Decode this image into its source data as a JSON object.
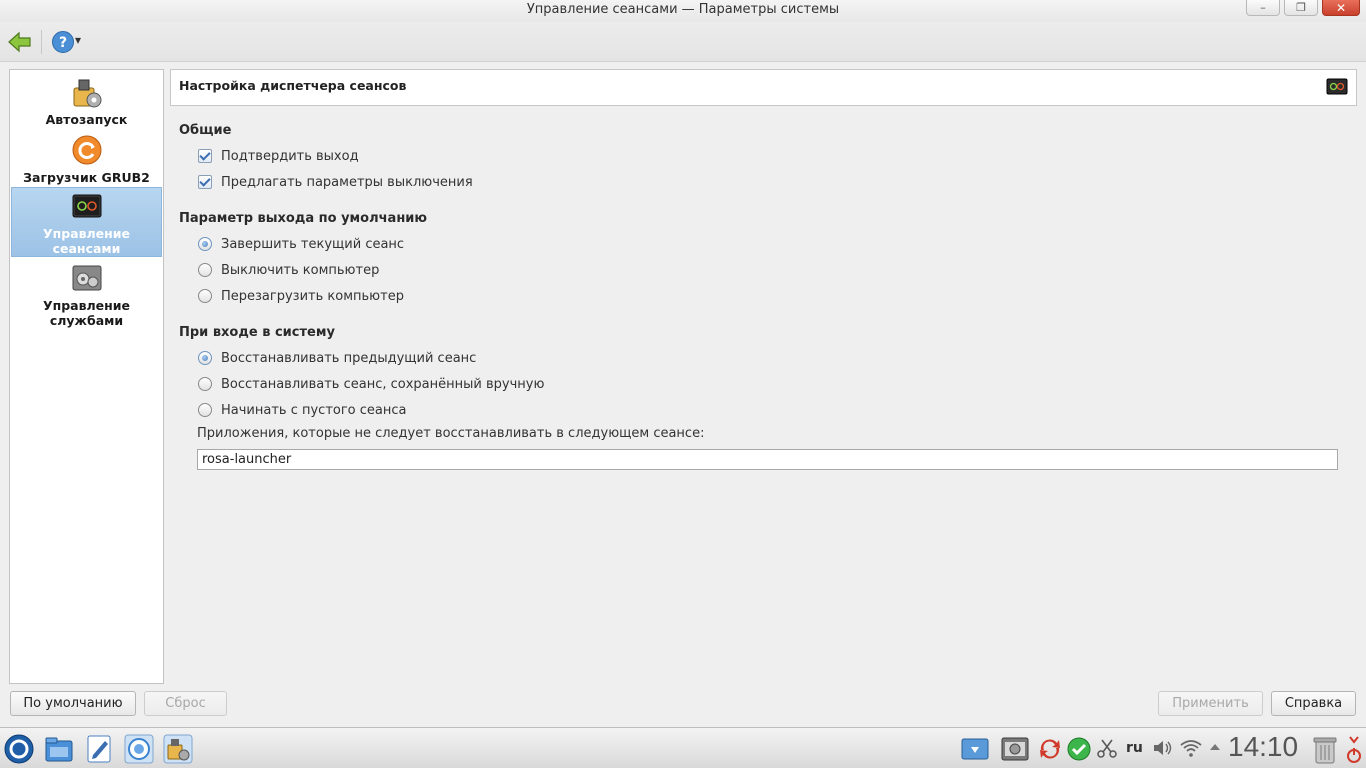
{
  "window": {
    "title": "Управление сеансами — Параметры системы",
    "buttons": {
      "minimize": "–",
      "maximize": "❐",
      "close": "✕"
    }
  },
  "toolbar": {
    "back_icon": "back-arrow-icon",
    "help_icon": "help-question-icon",
    "help_dropdown": "▾"
  },
  "sidebar": {
    "items": [
      {
        "label": "Автозапуск",
        "icon": "autostart-icon"
      },
      {
        "label": "Загрузчик GRUB2",
        "icon": "grub-icon"
      },
      {
        "label": "Управление сеансами",
        "icon": "session-icon",
        "selected": true
      },
      {
        "label": "Управление службами",
        "icon": "services-icon"
      }
    ]
  },
  "header": {
    "title": "Настройка диспетчера сеансов",
    "icon": "session-manager-icon"
  },
  "sections": {
    "general": {
      "title": "Общие",
      "confirm_logout": {
        "label": "Подтвердить выход",
        "checked": true
      },
      "offer_shutdown": {
        "label": "Предлагать параметры выключения",
        "checked": true
      }
    },
    "default_leave": {
      "title": "Параметр выхода по умолчанию",
      "options": [
        {
          "label": "Завершить текущий сеанс",
          "checked": true
        },
        {
          "label": "Выключить компьютер",
          "checked": false
        },
        {
          "label": "Перезагрузить компьютер",
          "checked": false
        }
      ]
    },
    "on_login": {
      "title": "При входе в систему",
      "options": [
        {
          "label": "Восстанавливать предыдущий сеанс",
          "checked": true
        },
        {
          "label": "Восстанавливать сеанс, сохранённый вручную",
          "checked": false
        },
        {
          "label": "Начинать с пустого сеанса",
          "checked": false
        }
      ],
      "exclude_label": "Приложения, которые не следует восстанавливать в следующем сеансе:",
      "exclude_value": "rosa-launcher"
    }
  },
  "buttons": {
    "defaults": "По умолчанию",
    "reset": "Сброс",
    "apply": "Применить",
    "help": "Справка"
  },
  "taskbar": {
    "launcher_icon": "rosa-launcher-icon",
    "apps": [
      "file-manager-icon",
      "text-editor-icon",
      "browser-icon",
      "system-settings-icon"
    ],
    "tray": [
      "disk-icon",
      "system-monitor-icon",
      "update-icon",
      "check-icon",
      "scissors-icon"
    ],
    "language": "ru",
    "tray_right": [
      "volume-icon",
      "wifi-icon",
      "expand-arrow-icon"
    ],
    "clock": "14:10",
    "trash_icon": "trash-icon",
    "power_icon": "power-icon",
    "accent_red": "#d03a2b",
    "accent_blue": "#3b6db1"
  }
}
